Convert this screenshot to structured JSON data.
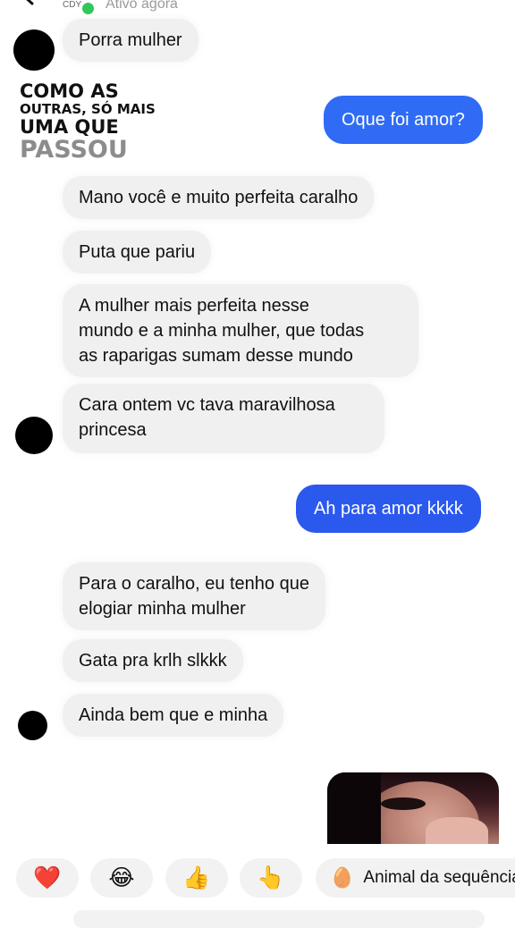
{
  "header": {
    "status": "Ativo agora",
    "badge": "CDY"
  },
  "overlay": {
    "line1": "COMO AS",
    "line2": "OUTRAS, SÓ MAIS",
    "line3": "UMA QUE",
    "line4": "PASSOU"
  },
  "messages": [
    {
      "side": "received",
      "text": "Porra mulher"
    },
    {
      "side": "sent",
      "text": "Oque foi amor?"
    },
    {
      "side": "received",
      "text": "Mano você e muito perfeita caralho"
    },
    {
      "side": "received",
      "text": "Puta que pariu"
    },
    {
      "side": "received",
      "lines": [
        "A mulher mais perfeita nesse",
        "mundo e a minha mulher, que todas",
        "as raparigas sumam desse mundo"
      ]
    },
    {
      "side": "received",
      "lines": [
        "Cara ontem vc tava maravilhosa",
        "princesa"
      ]
    },
    {
      "side": "sent",
      "text": "Ah para amor kkkk"
    },
    {
      "side": "received",
      "lines": [
        "Para o caralho, eu tenho que",
        "elogiar minha mulher"
      ]
    },
    {
      "side": "received",
      "text": "Gata pra krlh slkkk"
    },
    {
      "side": "received",
      "text": "Ainda bem que e minha"
    }
  ],
  "quick_replies": [
    {
      "icon": "heart",
      "glyph": "❤️"
    },
    {
      "icon": "laughing-tears",
      "glyph": "😂"
    },
    {
      "icon": "thumbs-up",
      "glyph": "👍"
    },
    {
      "icon": "pointing-hand",
      "glyph": "👆"
    },
    {
      "icon": "egg-face",
      "glyph": "🥚",
      "label": "Animal da sequência"
    }
  ],
  "colors": {
    "sent_bubble": "#2f6bf5",
    "received_bubble": "#f0f0f0",
    "online": "#31c85a"
  }
}
